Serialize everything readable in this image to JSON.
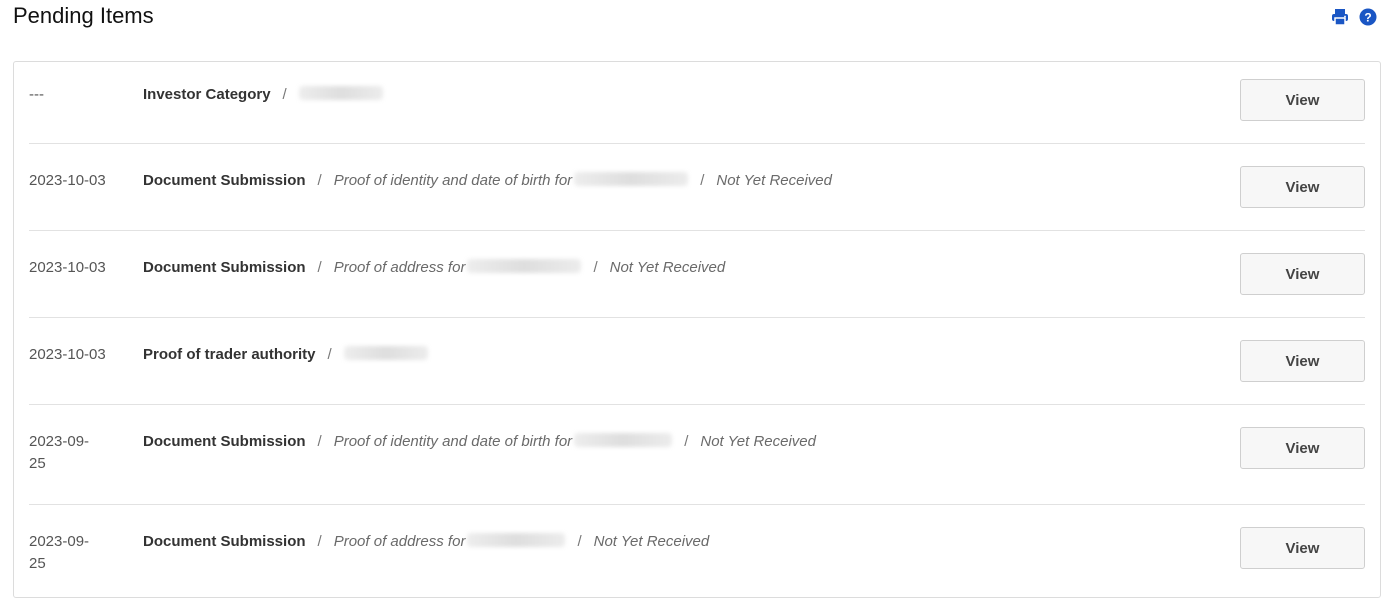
{
  "page": {
    "title": "Pending Items"
  },
  "toolbar": {
    "print_icon": "printer-icon",
    "help_icon": "help-circle-icon",
    "accent_color": "#1a56c4"
  },
  "rows": [
    {
      "date": "---",
      "type": "Investor Category",
      "separator": "/",
      "detail": "",
      "status": "",
      "button": "View"
    },
    {
      "date": "2023-10-03",
      "type": "Document Submission",
      "separator": "/",
      "detail": "Proof of identity and date of birth for",
      "status": "Not Yet Received",
      "button": "View"
    },
    {
      "date": "2023-10-03",
      "type": "Document Submission",
      "separator": "/",
      "detail": "Proof of address for",
      "status": "Not Yet Received",
      "button": "View"
    },
    {
      "date": "2023-10-03",
      "type": "Proof of trader authority",
      "separator": "/",
      "detail": "",
      "status": "",
      "button": "View"
    },
    {
      "date": "2023-09-25",
      "type": "Document Submission",
      "separator": "/",
      "detail": "Proof of identity and date of birth for",
      "status": "Not Yet Received",
      "button": "View"
    },
    {
      "date": "2023-09-25",
      "type": "Document Submission",
      "separator": "/",
      "detail": "Proof of address for",
      "status": "Not Yet Received",
      "button": "View"
    }
  ]
}
